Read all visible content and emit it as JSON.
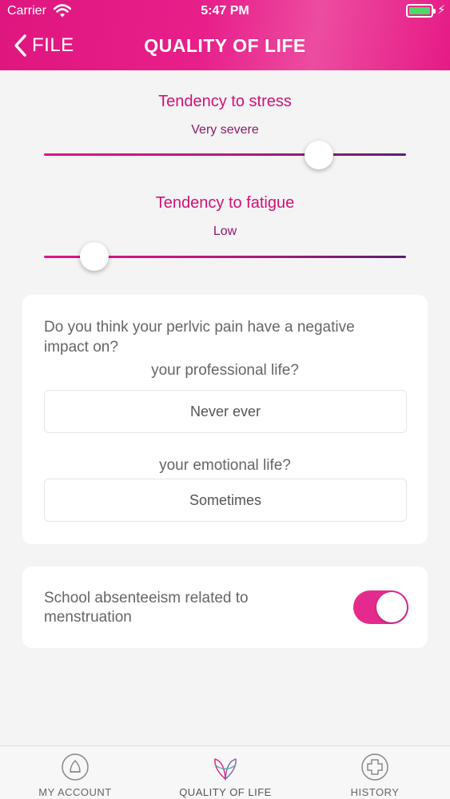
{
  "status_bar": {
    "carrier": "Carrier",
    "time": "5:47 PM"
  },
  "header": {
    "back_label": "FILE",
    "title": "QUALITY OF LIFE"
  },
  "sliders": [
    {
      "title": "Tendency to stress",
      "value_label": "Very severe",
      "position": 0.76
    },
    {
      "title": "Tendency to fatigue",
      "value_label": "Low",
      "position": 0.14
    }
  ],
  "impact_card": {
    "question": "Do you think your perlvic pain have a negative impact on?",
    "professional": {
      "label": "your professional life?",
      "value": "Never ever"
    },
    "emotional": {
      "label": "your emotional life?",
      "value": "Sometimes"
    }
  },
  "absenteeism": {
    "label": "School absenteeism related to menstruation",
    "enabled": true
  },
  "tabs": [
    {
      "label": "MY ACCOUNT",
      "icon": "account-icon",
      "active": false
    },
    {
      "label": "QUALITY OF LIFE",
      "icon": "quality-of-life-icon",
      "active": true
    },
    {
      "label": "HISTORY",
      "icon": "history-plus-icon",
      "active": false
    }
  ],
  "colors": {
    "accent": "#e0167f",
    "toggle_on": "#e52a8e",
    "battery": "#4cd964"
  }
}
